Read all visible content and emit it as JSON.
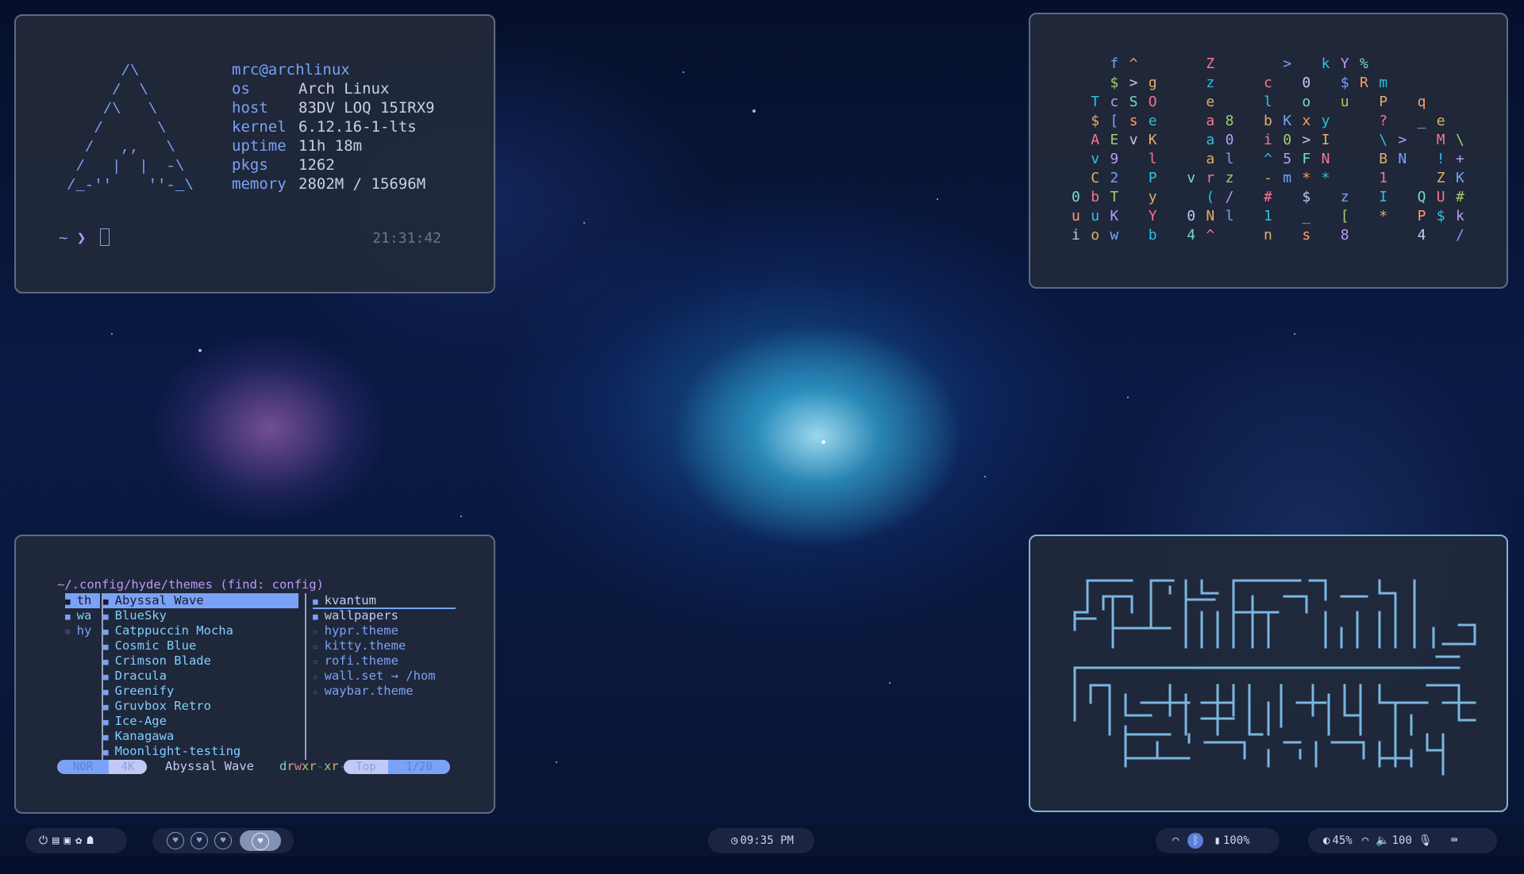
{
  "fetch": {
    "ascii_logo": "      /\\\n     /  \\\n    /\\   \\\n   /      \\\n  /   ,,   \\\n /   |  |  -\\\n/_-''    ''-_\\",
    "user_host": "mrc@archlinux",
    "rows": [
      {
        "key": "os",
        "value": "Arch Linux"
      },
      {
        "key": "host",
        "value": "83DV LOQ 15IRX9"
      },
      {
        "key": "kernel",
        "value": "6.12.16-1-lts"
      },
      {
        "key": "uptime",
        "value": "11h 18m"
      },
      {
        "key": "pkgs",
        "value": "1262"
      },
      {
        "key": "memory",
        "value": "2802M / 15696M"
      }
    ],
    "prompt_dir": "~",
    "prompt_symbol": "❯",
    "time": "21:31:42"
  },
  "matrix": {
    "rows": [
      "    f ^       Z       >   k Y %",
      "    $ > g     z     c   0   $ R m",
      "  T c S O     e     l   o   u   P   q",
      "  $ [ s e     a 8   b K x y     ?   _ e",
      "  A E v K     a 0   i 0 > I     \\ >   M \\",
      "  v 9   l     a l   ^ 5 F N     B N   ! +",
      "  C 2   P   v r z   - m * *     1     Z K",
      "0 b T   y     ( /   #   $   z   I   Q U #",
      "u u K   Y   0 N l   1   _   [   *   P $ k",
      "i o w   b   4 ^     n   s   8       4   /"
    ],
    "colors": [
      "#c0caf5",
      "#7aa2f7",
      "#2ac3de",
      "#73daca",
      "#9ece6a",
      "#e0af68",
      "#ff9e64",
      "#bb9af7",
      "#f7768e"
    ]
  },
  "files": {
    "path": "~/.config/hyde/themes (find: config)",
    "parent": [
      {
        "label": "th",
        "type": "dir",
        "selected": true
      },
      {
        "label": "wa",
        "type": "dir"
      },
      {
        "label": "hy",
        "type": "cfg"
      }
    ],
    "current": [
      {
        "label": "Abyssal Wave",
        "selected": true
      },
      {
        "label": "BlueSky"
      },
      {
        "label": "Catppuccin Mocha"
      },
      {
        "label": "Cosmic Blue"
      },
      {
        "label": "Crimson Blade"
      },
      {
        "label": "Dracula"
      },
      {
        "label": "Greenify"
      },
      {
        "label": "Gruvbox Retro"
      },
      {
        "label": "Ice-Age"
      },
      {
        "label": "Kanagawa"
      },
      {
        "label": "Moonlight-testing"
      }
    ],
    "preview": [
      {
        "label": "kvantum",
        "type": "dir"
      },
      {
        "label": "wallpapers",
        "type": "dir"
      },
      {
        "label": "hypr.theme",
        "type": "file"
      },
      {
        "label": "kitty.theme",
        "type": "file"
      },
      {
        "label": "rofi.theme",
        "type": "file"
      },
      {
        "label": "wall.set → /hom",
        "type": "link"
      },
      {
        "label": "waybar.theme",
        "type": "file"
      }
    ],
    "status": {
      "mode": "NOR",
      "tag": "4K",
      "name": "Abyssal Wave",
      "perm": "drwxr-xr-x",
      "position": "Top",
      "count": "1/20"
    }
  },
  "taskbar": {
    "left_icons": [
      "power-icon",
      "files-icon",
      "windows-icon",
      "palette-icon",
      "ghost-icon"
    ],
    "clock": "09:35 PM",
    "battery": "100%",
    "brightness": "45%",
    "volume": "100"
  }
}
